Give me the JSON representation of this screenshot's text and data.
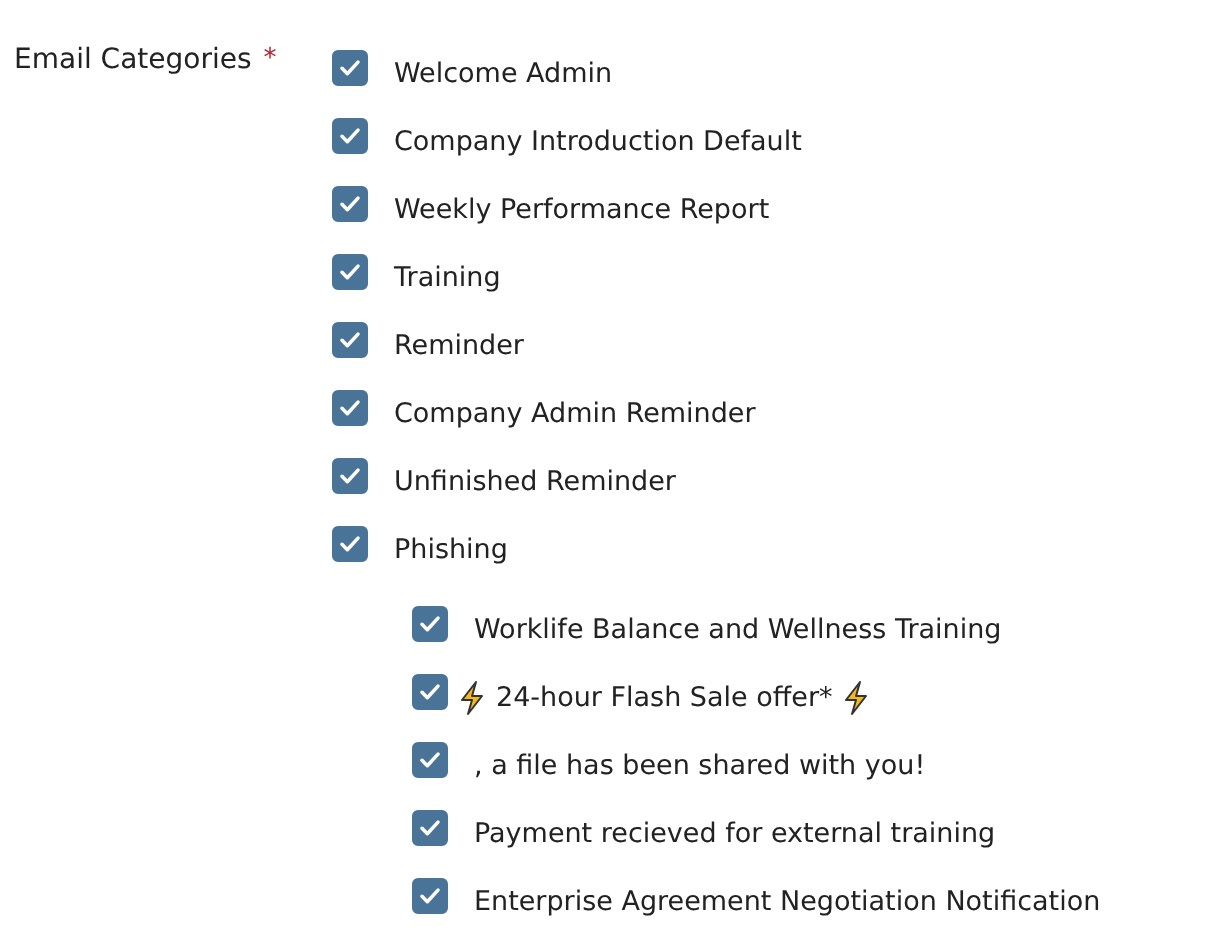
{
  "field": {
    "label": "Email Categories",
    "required_marker": "*",
    "options": [
      {
        "label": "Welcome Admin",
        "checked": true
      },
      {
        "label": "Company Introduction Default",
        "checked": true
      },
      {
        "label": "Weekly Performance Report",
        "checked": true
      },
      {
        "label": "Training",
        "checked": true
      },
      {
        "label": "Reminder",
        "checked": true
      },
      {
        "label": "Company Admin Reminder",
        "checked": true
      },
      {
        "label": "Unfinished Reminder",
        "checked": true
      },
      {
        "label": "Phishing",
        "checked": true,
        "children": [
          {
            "label": "Worklife Balance and Wellness Training",
            "checked": true
          },
          {
            "label": "24-hour Flash Sale offer*",
            "checked": true,
            "lightning": true
          },
          {
            "label": ", a file has been shared with you!",
            "checked": true
          },
          {
            "label": "Payment recieved for external training",
            "checked": true
          },
          {
            "label": "Enterprise Agreement Negotiation Notification",
            "checked": true
          }
        ]
      }
    ]
  }
}
